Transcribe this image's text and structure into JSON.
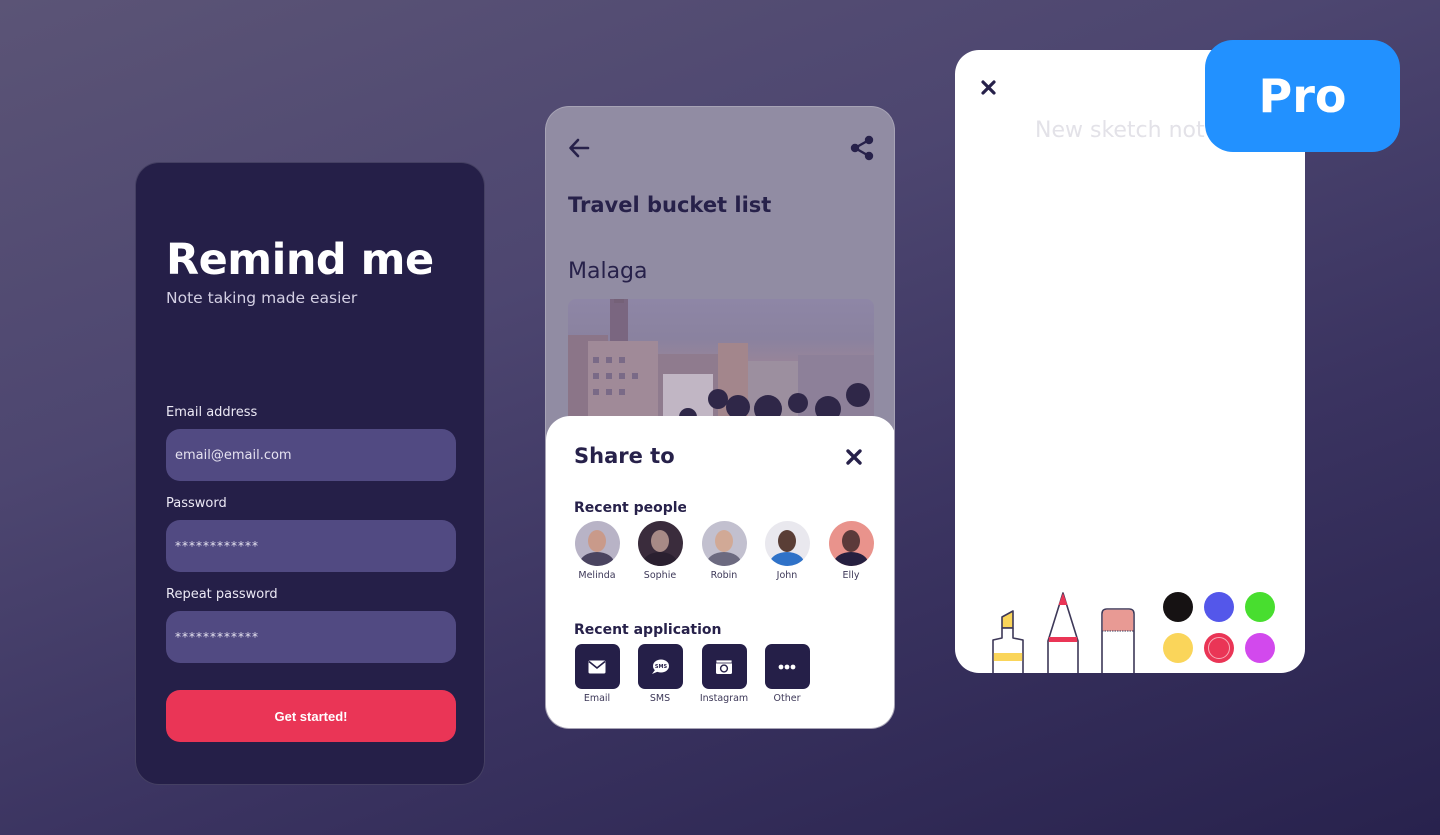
{
  "login": {
    "title": "Remind me",
    "subtitle": "Note taking made easier",
    "email_label": "Email address",
    "email_value": "email@email.com",
    "password_label": "Password",
    "password_value": "************",
    "repeat_label": "Repeat password",
    "repeat_value": "************",
    "submit_label": "Get started!"
  },
  "note": {
    "back_icon": "arrow-left-icon",
    "share_icon": "share-icon",
    "title": "Travel bucket list",
    "entry": "Malaga",
    "photo_alt": "Malaga city skyline"
  },
  "share": {
    "title": "Share to",
    "close_icon": "close-icon",
    "people_label": "Recent people",
    "people": [
      {
        "name": "Melinda",
        "bg": "#b8b3c6",
        "skin": "#c99a8a",
        "shirt": "#4a4460"
      },
      {
        "name": "Sophie",
        "bg": "#3a2c3c",
        "skin": "#a78a86",
        "shirt": "#2a2030"
      },
      {
        "name": "Robin",
        "bg": "#c2c0cf",
        "skin": "#d1a996",
        "shirt": "#6c6a80"
      },
      {
        "name": "John",
        "bg": "#e9e8ee",
        "skin": "#5a3e36",
        "shirt": "#2f72c8"
      },
      {
        "name": "Elly",
        "bg": "#e9938c",
        "skin": "#5b3a3a",
        "shirt": "#262040"
      }
    ],
    "apps_label": "Recent applications",
    "apps": [
      {
        "name": "Email",
        "icon": "envelope-icon"
      },
      {
        "name": "SMS",
        "icon": "sms-bubble-icon"
      },
      {
        "name": "Instagram",
        "icon": "instagram-icon"
      },
      {
        "name": "Other",
        "icon": "more-dots-icon"
      }
    ]
  },
  "sketch": {
    "close_icon": "close-icon",
    "placeholder": "New sketch note",
    "tools": [
      {
        "name": "highlighter",
        "color": "#fad55a"
      },
      {
        "name": "marker",
        "color": "#ea3556"
      },
      {
        "name": "eraser",
        "color": "#e89a94"
      }
    ],
    "colors": [
      {
        "name": "black",
        "hex": "#161213",
        "selected": false
      },
      {
        "name": "blue",
        "hex": "#5457ea",
        "selected": false
      },
      {
        "name": "green",
        "hex": "#48de2f",
        "selected": false
      },
      {
        "name": "yellow",
        "hex": "#fad55a",
        "selected": false
      },
      {
        "name": "red",
        "hex": "#ea3556",
        "selected": true
      },
      {
        "name": "purple",
        "hex": "#d249ed",
        "selected": false
      }
    ]
  },
  "badge": {
    "label": "Pro",
    "color": "#2291ff"
  },
  "theme": {
    "navy": "#251f48",
    "input": "#514a82",
    "accent_red": "#ea3556"
  }
}
